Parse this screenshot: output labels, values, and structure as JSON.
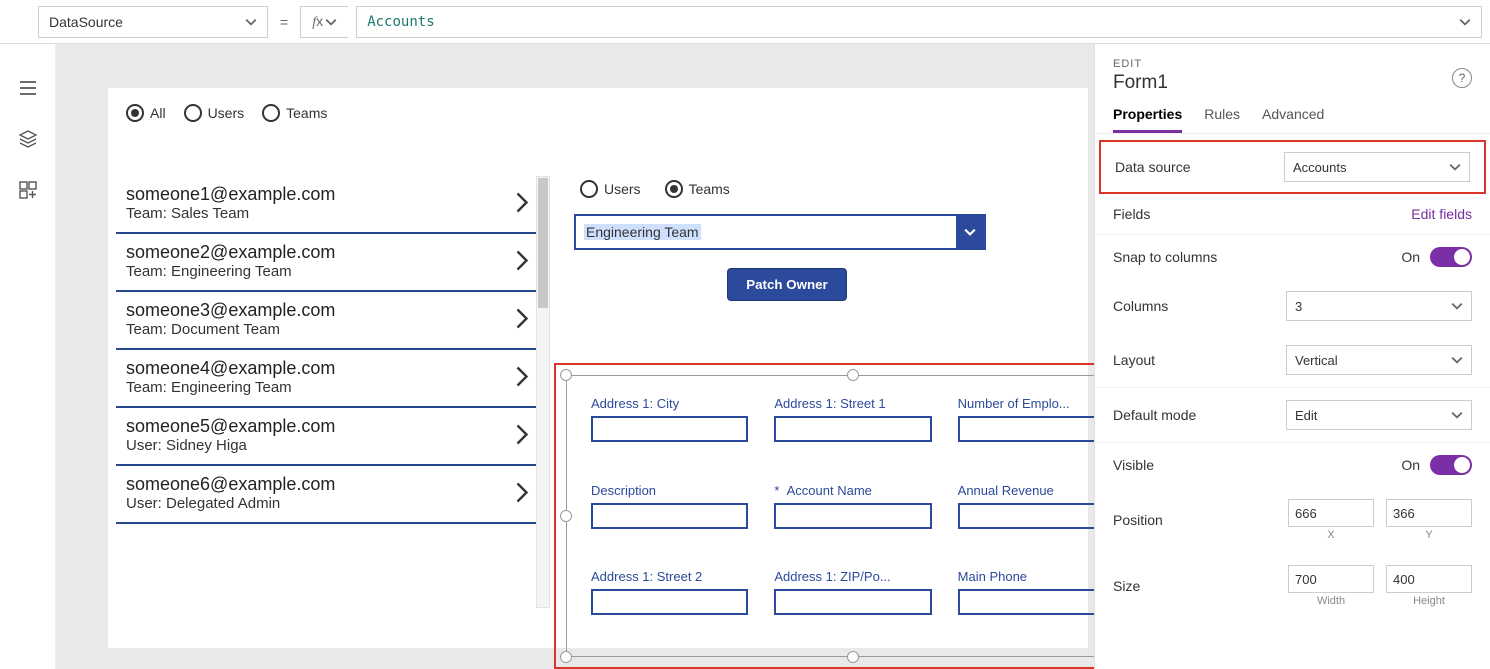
{
  "formulaBar": {
    "property": "DataSource",
    "eq": "=",
    "value": "Accounts"
  },
  "canvas": {
    "topFilter": {
      "opts": [
        "All",
        "Users",
        "Teams"
      ],
      "selected": "All"
    },
    "innerFilter": {
      "opts": [
        "Users",
        "Teams"
      ],
      "selected": "Teams"
    },
    "combo": "Engineering Team",
    "patchBtn": "Patch Owner",
    "list": [
      {
        "title": "someone1@example.com",
        "sub": "Team: Sales Team"
      },
      {
        "title": "someone2@example.com",
        "sub": "Team: Engineering Team"
      },
      {
        "title": "someone3@example.com",
        "sub": "Team: Document Team"
      },
      {
        "title": "someone4@example.com",
        "sub": "Team: Engineering Team"
      },
      {
        "title": "someone5@example.com",
        "sub": "User: Sidney Higa"
      },
      {
        "title": "someone6@example.com",
        "sub": "User: Delegated Admin"
      }
    ],
    "form": {
      "fields": [
        {
          "label": "Address 1: City",
          "req": false
        },
        {
          "label": "Address 1: Street 1",
          "req": false
        },
        {
          "label": "Number of Emplo...",
          "req": false
        },
        {
          "label": "Description",
          "req": false
        },
        {
          "label": "Account Name",
          "req": true
        },
        {
          "label": "Annual Revenue",
          "req": false
        },
        {
          "label": "Address 1: Street 2",
          "req": false
        },
        {
          "label": "Address 1: ZIP/Po...",
          "req": false
        },
        {
          "label": "Main Phone",
          "req": false
        }
      ]
    }
  },
  "props": {
    "editLabel": "EDIT",
    "title": "Form1",
    "tabs": {
      "properties": "Properties",
      "rules": "Rules",
      "advanced": "Advanced"
    },
    "dataSource": {
      "label": "Data source",
      "value": "Accounts"
    },
    "fields": {
      "label": "Fields",
      "link": "Edit fields"
    },
    "snap": {
      "label": "Snap to columns",
      "value": "On"
    },
    "columns": {
      "label": "Columns",
      "value": "3"
    },
    "layout": {
      "label": "Layout",
      "value": "Vertical"
    },
    "defaultMode": {
      "label": "Default mode",
      "value": "Edit"
    },
    "visible": {
      "label": "Visible",
      "value": "On"
    },
    "position": {
      "label": "Position",
      "x": "666",
      "y": "366",
      "xl": "X",
      "yl": "Y"
    },
    "size": {
      "label": "Size",
      "w": "700",
      "h": "400",
      "wl": "Width",
      "hl": "Height"
    }
  }
}
